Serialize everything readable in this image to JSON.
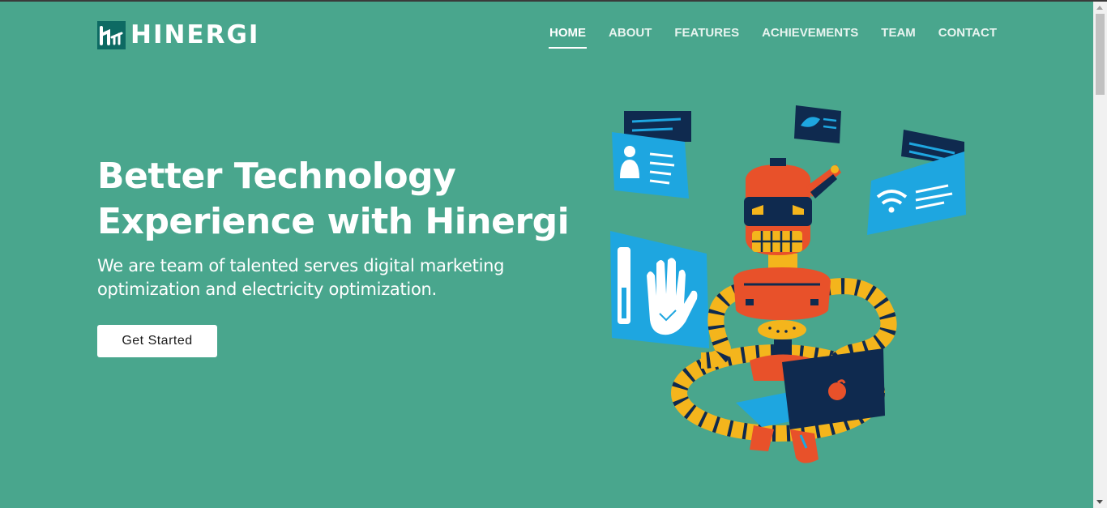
{
  "brand": {
    "name": "HINERGI",
    "logo_icon": "hinergi-logo-icon"
  },
  "nav": {
    "items": [
      {
        "label": "HOME",
        "active": true
      },
      {
        "label": "ABOUT",
        "active": false
      },
      {
        "label": "FEATURES",
        "active": false
      },
      {
        "label": "ACHIEVEMENTS",
        "active": false
      },
      {
        "label": "TEAM",
        "active": false
      },
      {
        "label": "CONTACT",
        "active": false
      }
    ]
  },
  "hero": {
    "title_line1": "Better Technology",
    "title_line2": "Experience with Hinergi",
    "subtitle_line1": "We are team of talented serves digital marketing",
    "subtitle_line2": "optimization and electricity optimization.",
    "cta_label": "Get Started",
    "illustration_icon": "robot-with-laptop-illustration"
  },
  "colors": {
    "background": "#49a68d",
    "logo_bg": "#0d6a63",
    "robot_orange": "#e8512a",
    "robot_yellow": "#f4b51c",
    "panel_blue": "#1ea6e0",
    "navy": "#0f2a4f"
  }
}
